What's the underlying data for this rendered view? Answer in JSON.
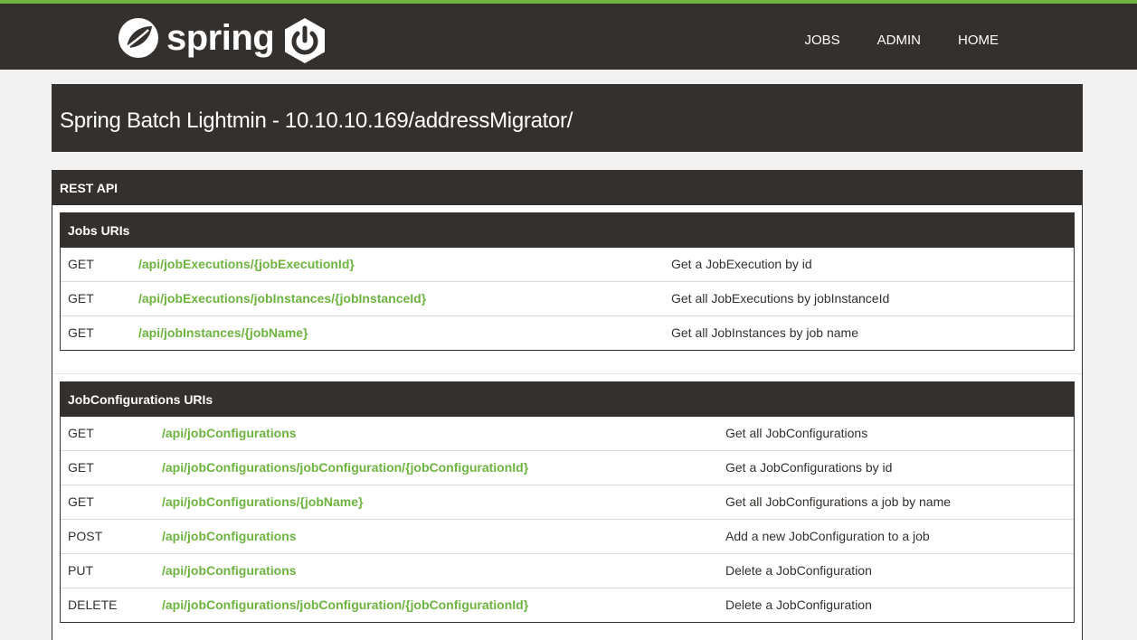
{
  "header": {
    "brand": "spring",
    "nav": [
      "JOBS",
      "ADMIN",
      "HOME"
    ]
  },
  "page": {
    "title": "Spring Batch Lightmin - 10.10.10.169/addressMigrator/"
  },
  "rest_api": {
    "title": "REST API",
    "groups": [
      {
        "title": "Jobs URIs",
        "rows": [
          {
            "method": "GET",
            "uri": "/api/jobExecutions/{jobExecutionId}",
            "description": "Get a JobExecution by id"
          },
          {
            "method": "GET",
            "uri": "/api/jobExecutions/jobInstances/{jobInstanceId}",
            "description": "Get all JobExecutions by jobInstanceId"
          },
          {
            "method": "GET",
            "uri": "/api/jobInstances/{jobName}",
            "description": "Get all JobInstances by job name"
          }
        ]
      },
      {
        "title": "JobConfigurations URIs",
        "rows": [
          {
            "method": "GET",
            "uri": "/api/jobConfigurations",
            "description": "Get all JobConfigurations"
          },
          {
            "method": "GET",
            "uri": "/api/jobConfigurations/jobConfiguration/{jobConfigurationId}",
            "description": "Get a JobConfigurations by id"
          },
          {
            "method": "GET",
            "uri": "/api/jobConfigurations/{jobName}",
            "description": "Get all JobConfigurations a job by name"
          },
          {
            "method": "POST",
            "uri": "/api/jobConfigurations",
            "description": "Add a new JobConfiguration to a job"
          },
          {
            "method": "PUT",
            "uri": "/api/jobConfigurations",
            "description": "Delete a JobConfiguration"
          },
          {
            "method": "DELETE",
            "uri": "/api/jobConfigurations/jobConfiguration/{jobConfigurationId}",
            "description": "Delete a JobConfiguration"
          }
        ]
      }
    ]
  },
  "colors": {
    "accent": "#6db33f",
    "dark": "#34302d",
    "background": "#f1f1f1"
  }
}
